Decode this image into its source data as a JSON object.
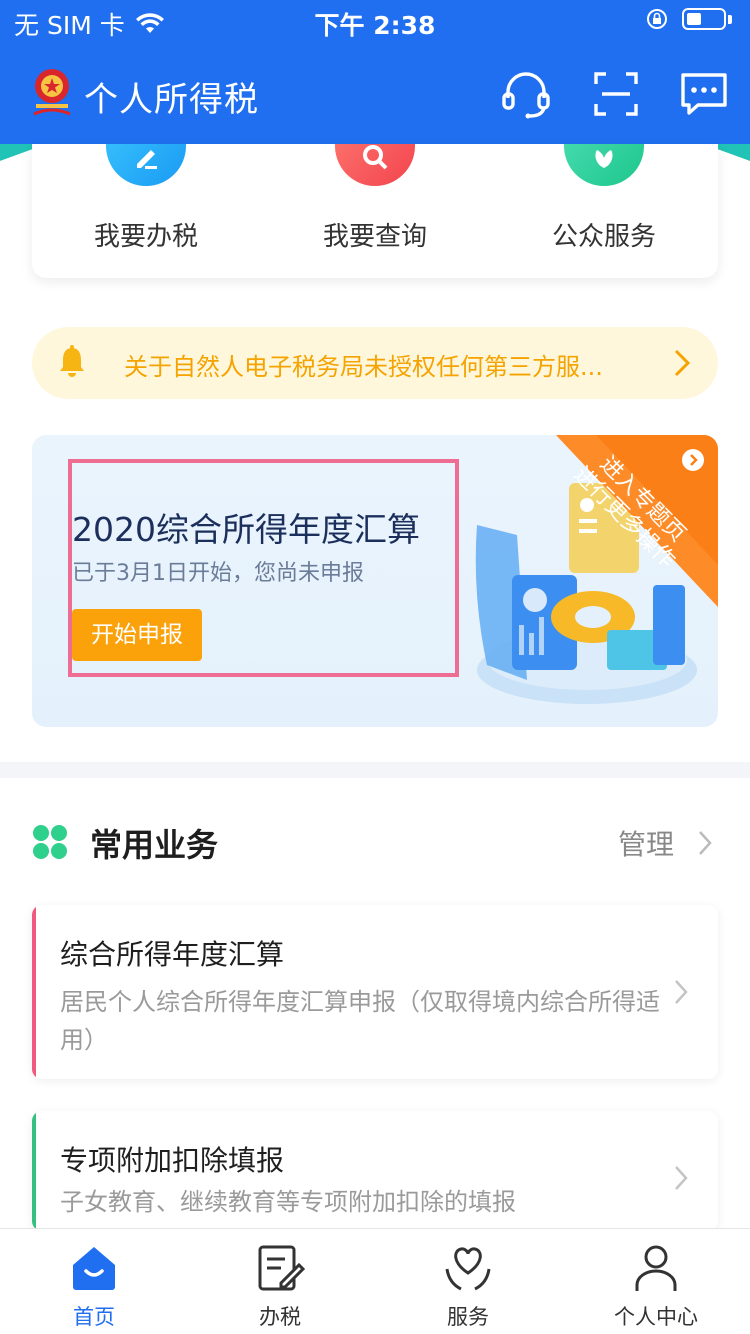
{
  "status_bar": {
    "carrier": "无 SIM 卡",
    "time": "下午 2:38"
  },
  "nav": {
    "title": "个人所得税"
  },
  "quick_actions": [
    {
      "label": "我要办税",
      "icon": "pencil-icon"
    },
    {
      "label": "我要查询",
      "icon": "search-icon"
    },
    {
      "label": "公众服务",
      "icon": "leaf-icon"
    }
  ],
  "notice": {
    "text": "关于自然人电子税务局未授权任何第三方服..."
  },
  "banner": {
    "title": "2020综合所得年度汇算",
    "subtitle": "已于3月1日开始，您尚未申报",
    "button": "开始申报",
    "ribbon_line1": "进入专题页",
    "ribbon_line2": "进行更多操作"
  },
  "section": {
    "title": "常用业务",
    "manage": "管理"
  },
  "services": [
    {
      "title": "综合所得年度汇算",
      "desc": "居民个人综合所得年度汇算申报（仅取得境内综合所得适用）"
    },
    {
      "title": "专项附加扣除填报",
      "desc": "子女教育、继续教育等专项附加扣除的填报"
    }
  ],
  "tabs": [
    {
      "label": "首页",
      "icon": "home-icon",
      "active": true
    },
    {
      "label": "办税",
      "icon": "document-edit-icon",
      "active": false
    },
    {
      "label": "服务",
      "icon": "heart-hands-icon",
      "active": false
    },
    {
      "label": "个人中心",
      "icon": "user-icon",
      "active": false
    }
  ],
  "colors": {
    "primary": "#1f6ff0",
    "notice_text": "#f5a300",
    "banner_button": "#fba10a",
    "ribbon": "#fb7f17",
    "highlight_border": "#ee6e93",
    "card1_accent": "#f05a7e",
    "card2_accent": "#34c07f"
  }
}
